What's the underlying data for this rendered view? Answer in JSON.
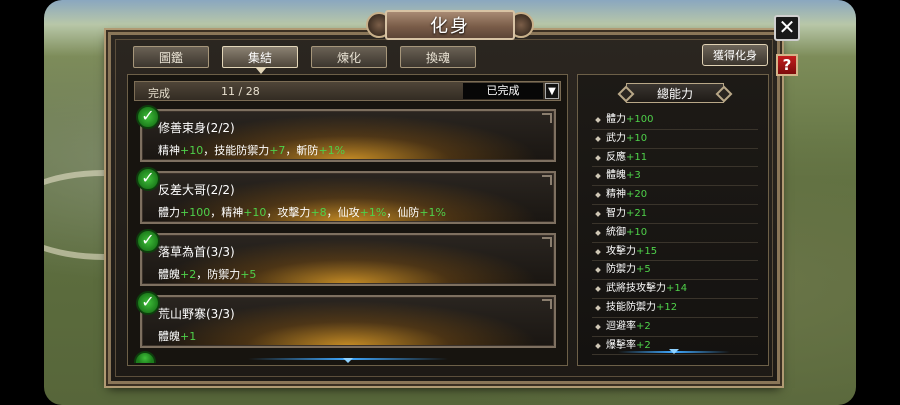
{
  "window": {
    "title": "化身"
  },
  "tabs": [
    {
      "label": "圖鑑",
      "active": false
    },
    {
      "label": "集結",
      "active": true
    },
    {
      "label": "煉化",
      "active": false
    },
    {
      "label": "換魂",
      "active": false
    }
  ],
  "obtain_button": "獲得化身",
  "close_button": "✕",
  "help_button": "?",
  "filter": {
    "label": "完成",
    "count": "11 / 28",
    "selected": "已完成",
    "arrow_icon": "triangle-down-icon"
  },
  "collections": [
    {
      "name": "修善束身(2/2)",
      "stats": [
        {
          "text": "精神",
          "bonus": "+10"
        },
        {
          "text": "，技能防禦力",
          "bonus": "+7"
        },
        {
          "text": "，斬防",
          "bonus": "+1%"
        }
      ]
    },
    {
      "name": "反差大哥(2/2)",
      "stats": [
        {
          "text": "體力",
          "bonus": "+100"
        },
        {
          "text": "，精神",
          "bonus": "+10"
        },
        {
          "text": "，攻擊力",
          "bonus": "+8"
        },
        {
          "text": "，仙攻",
          "bonus": "+1%"
        },
        {
          "text": "，仙防",
          "bonus": "+1%"
        }
      ]
    },
    {
      "name": "落草為首(3/3)",
      "stats": [
        {
          "text": "體魄",
          "bonus": "+2"
        },
        {
          "text": "，防禦力",
          "bonus": "+5"
        }
      ]
    },
    {
      "name": "荒山野寨(3/3)",
      "stats": [
        {
          "text": "體魄",
          "bonus": "+1"
        }
      ]
    }
  ],
  "total_panel": {
    "title": "總能力",
    "attributes": [
      {
        "name": "體力",
        "value": "+100"
      },
      {
        "name": "武力",
        "value": "+10"
      },
      {
        "name": "反應",
        "value": "+11"
      },
      {
        "name": "體魄",
        "value": "+3"
      },
      {
        "name": "精神",
        "value": "+20"
      },
      {
        "name": "智力",
        "value": "+21"
      },
      {
        "name": "統御",
        "value": "+10"
      },
      {
        "name": "攻擊力",
        "value": "+15"
      },
      {
        "name": "防禦力",
        "value": "+5"
      },
      {
        "name": "武將技攻擊力",
        "value": "+14"
      },
      {
        "name": "技能防禦力",
        "value": "+12"
      },
      {
        "name": "迴避率",
        "value": "+2"
      },
      {
        "name": "爆擊率",
        "value": "+2"
      }
    ]
  },
  "colors": {
    "bonus": "#4fd14a",
    "frame": "#8a7658",
    "glow": "#e2a028"
  }
}
